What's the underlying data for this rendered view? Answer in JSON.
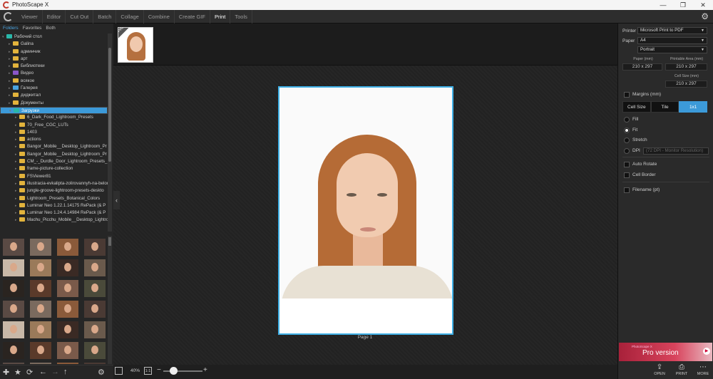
{
  "window": {
    "title": "PhotoScape X",
    "minimize": "—",
    "maximize": "❐",
    "close": "✕"
  },
  "menu": {
    "tabs": [
      {
        "label": "Viewer"
      },
      {
        "label": "Editor"
      },
      {
        "label": "Cut Out"
      },
      {
        "label": "Batch"
      },
      {
        "label": "Collage"
      },
      {
        "label": "Combine"
      },
      {
        "label": "Create GIF"
      },
      {
        "label": "Print"
      },
      {
        "label": "Tools"
      }
    ],
    "active": "Print",
    "settings_icon": "gear-icon"
  },
  "left": {
    "source_tabs": [
      "Folders",
      "Favorites",
      "Both"
    ],
    "tree": [
      {
        "label": "Рабочий стол",
        "level": 0,
        "type": "teal",
        "open": true
      },
      {
        "label": "Galina",
        "level": 1,
        "type": "folder"
      },
      {
        "label": "админчик",
        "level": 1,
        "type": "folder"
      },
      {
        "label": "арт",
        "level": 1,
        "type": "folder"
      },
      {
        "label": "Библиотеки",
        "level": 1,
        "type": "folder"
      },
      {
        "label": "Видео",
        "level": 1,
        "type": "purple"
      },
      {
        "label": "всякое",
        "level": 1,
        "type": "folder"
      },
      {
        "label": "Галерея",
        "level": 1,
        "type": "blue"
      },
      {
        "label": "диджитал",
        "level": 1,
        "type": "folder"
      },
      {
        "label": "Документы",
        "level": 1,
        "type": "folder"
      },
      {
        "label": "Загрузки",
        "level": 1,
        "type": "teal",
        "selected": true,
        "open": true
      },
      {
        "label": "6_Dark_Food_Lightroom_Presets",
        "level": 2,
        "type": "folder"
      },
      {
        "label": "70_Free_CGC_LUTs",
        "level": 2,
        "type": "folder"
      },
      {
        "label": "1403",
        "level": 2,
        "type": "folder"
      },
      {
        "label": "actions",
        "level": 2,
        "type": "folder"
      },
      {
        "label": "Bangor_Mobile__Desktop_Lightroom_Pr",
        "level": 2,
        "type": "folder"
      },
      {
        "label": "Bangor_Mobile__Desktop_Lightroom_Pr",
        "level": 2,
        "type": "folder"
      },
      {
        "label": "CM_-_Durdle_Door_Lightroom_Presets_",
        "level": 2,
        "type": "folder"
      },
      {
        "label": "frame-picture-collection",
        "level": 2,
        "type": "folder"
      },
      {
        "label": "FSViewer81",
        "level": 2,
        "type": "folder"
      },
      {
        "label": "illustracia-evkalipta-zolirovannyh-na-belom",
        "level": 2,
        "type": "folder"
      },
      {
        "label": "jungle-groove-lightroom-presets-deskto",
        "level": 2,
        "type": "folder"
      },
      {
        "label": "Lightroom_Presets_Botanical_Colors",
        "level": 2,
        "type": "folder"
      },
      {
        "label": "Luminar Neo 1.22.1.14175 RePack (& P",
        "level": 2,
        "type": "folder"
      },
      {
        "label": "Luminar Neo 1.24.4.14984 RePack (& P",
        "level": 2,
        "type": "folder"
      },
      {
        "label": "Machu_Picchu_Mobile__Desktop_Lightro",
        "level": 2,
        "type": "folder"
      }
    ]
  },
  "filmstrip": {
    "badge": "PRO"
  },
  "canvas": {
    "page_label": "Page 1"
  },
  "zoom": {
    "percent": "40%",
    "one_to_one": "1:1",
    "minus": "−",
    "plus": "+",
    "level": 0.25
  },
  "print": {
    "printer_label": "Printer",
    "printer_value": "Microsoft Print to PDF",
    "paper_label": "Paper",
    "paper_value": "A4",
    "orientation_value": "Portrait",
    "paper_mm_caption": "Paper (mm)",
    "paper_mm": "210 x 297",
    "printable_caption": "Printable Area (mm)",
    "printable_mm": "210 x 297",
    "cell_caption": "Cell Size (mm)",
    "cell_mm": "210 x 297",
    "margins_label": "Margins (mm)",
    "layout_tabs": [
      "Cell Size",
      "Tile",
      "1x1"
    ],
    "layout_active": "1x1",
    "fit_options": [
      "Fill",
      "Fit",
      "Stretch",
      "DPI"
    ],
    "fit_active": "Fit",
    "dpi_placeholder": "(72 DPI - Monitor Resolution)",
    "auto_rotate": "Auto Rotate",
    "cell_border": "Cell Border",
    "filename": "Filename (pt)"
  },
  "promo": {
    "small": "PhotoScape X",
    "big": "Pro version"
  },
  "bottom": {
    "open": "OPEN",
    "print": "PRINT",
    "more": "MORE"
  }
}
